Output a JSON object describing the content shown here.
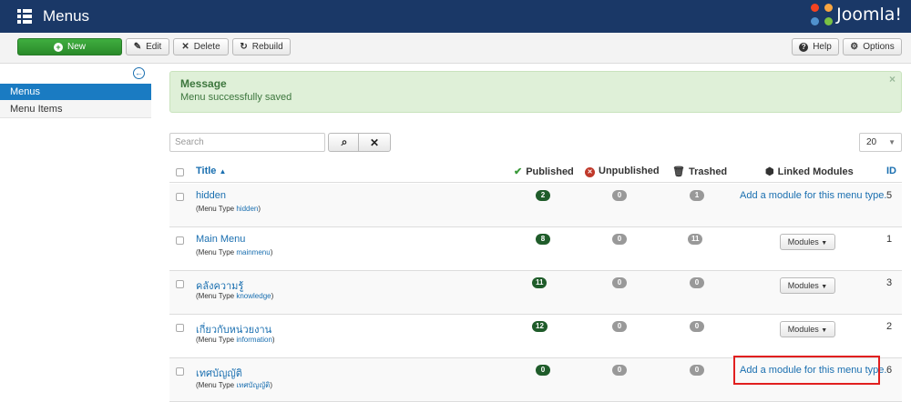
{
  "header": {
    "title": "Menus",
    "brand": "Joomla!",
    "colors": {
      "bar": "#1a3867"
    }
  },
  "toolbar": {
    "new_label": "New",
    "edit_label": "Edit",
    "delete_label": "Delete",
    "rebuild_label": "Rebuild",
    "help_label": "Help",
    "options_label": "Options"
  },
  "sidebar": {
    "items": [
      {
        "label": "Menus",
        "active": true
      },
      {
        "label": "Menu Items",
        "active": false
      }
    ]
  },
  "message": {
    "title": "Message",
    "text": "Menu successfully saved",
    "close": "×"
  },
  "filters": {
    "search_placeholder": "Search",
    "limit": "20"
  },
  "table": {
    "columns": {
      "title": "Title",
      "published": "Published",
      "unpublished": "Unpublished",
      "trashed": "Trashed",
      "linked": "Linked Modules",
      "id": "ID"
    },
    "type_prefix": "(Menu Type",
    "type_suffix": ")",
    "rows": [
      {
        "title": "hidden",
        "type": "hidden",
        "published": "2",
        "unpublished": "0",
        "trashed": "1",
        "linked": "Add a module for this menu type.",
        "id": "5"
      },
      {
        "title": "Main Menu",
        "type": "mainmenu",
        "published": "8",
        "unpublished": "0",
        "trashed": "11",
        "linked": "Modules",
        "id": "1"
      },
      {
        "title": "คลังความรู้",
        "type": "knowledge",
        "published": "11",
        "unpublished": "0",
        "trashed": "0",
        "linked": "Modules",
        "id": "3"
      },
      {
        "title": "เกี่ยวกับหน่วยงาน",
        "type": "information",
        "published": "12",
        "unpublished": "0",
        "trashed": "0",
        "linked": "Modules",
        "id": "2"
      },
      {
        "title": "เทศบัญญัติ",
        "type": "เทศบัญญัติ",
        "published": "0",
        "unpublished": "0",
        "trashed": "0",
        "linked": "Add a module for this menu type.",
        "id": "6"
      }
    ]
  }
}
